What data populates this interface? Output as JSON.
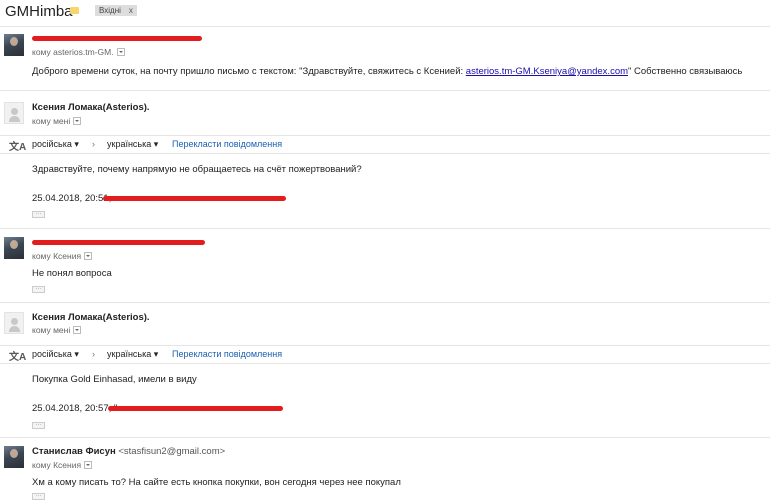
{
  "header": {
    "subject": "GMHimba",
    "label": "Вхідні",
    "label_close": "x"
  },
  "translate": {
    "icon": "translate-icon",
    "source": "російська ▾",
    "arrow": "›",
    "target": "українська ▾",
    "action": "Перекласти повідомлення"
  },
  "messages": [
    {
      "sender": "",
      "recipients": "кому asterios.tm-GM.",
      "body_pre": "Доброго времени суток, на почту пришло письмо с текстом: \"Здравствуйте, свяжитесь с Ксенией: ",
      "body_link": "asterios.tm-GM.Kseniya@yandex.com",
      "body_post": "\" Собственно связываюсь"
    },
    {
      "sender": "Ксения Ломака(Asterios).",
      "recipients": "кому мені",
      "body": "Здравствуйте, почему напрямую не обращаетесь на счёт пожертвований?",
      "quote": "25.04.2018, 20:51,"
    },
    {
      "sender": "",
      "recipients": "кому Ксения",
      "body": "Не понял вопроса"
    },
    {
      "sender": "Ксения Ломака(Asterios).",
      "recipients": "кому мені",
      "body": "Покупка Gold Einhasad, имели в виду",
      "quote": "25.04.2018, 20:57, \""
    },
    {
      "sender": "Станислав Фисун",
      "sender_email": "<stasfisun2@gmail.com>",
      "recipients": "кому Ксения",
      "body": "Хм а кому писать то? На сайте есть кнопка покупки, вон сегодня через нее покупал"
    }
  ],
  "ellipsis": "···"
}
